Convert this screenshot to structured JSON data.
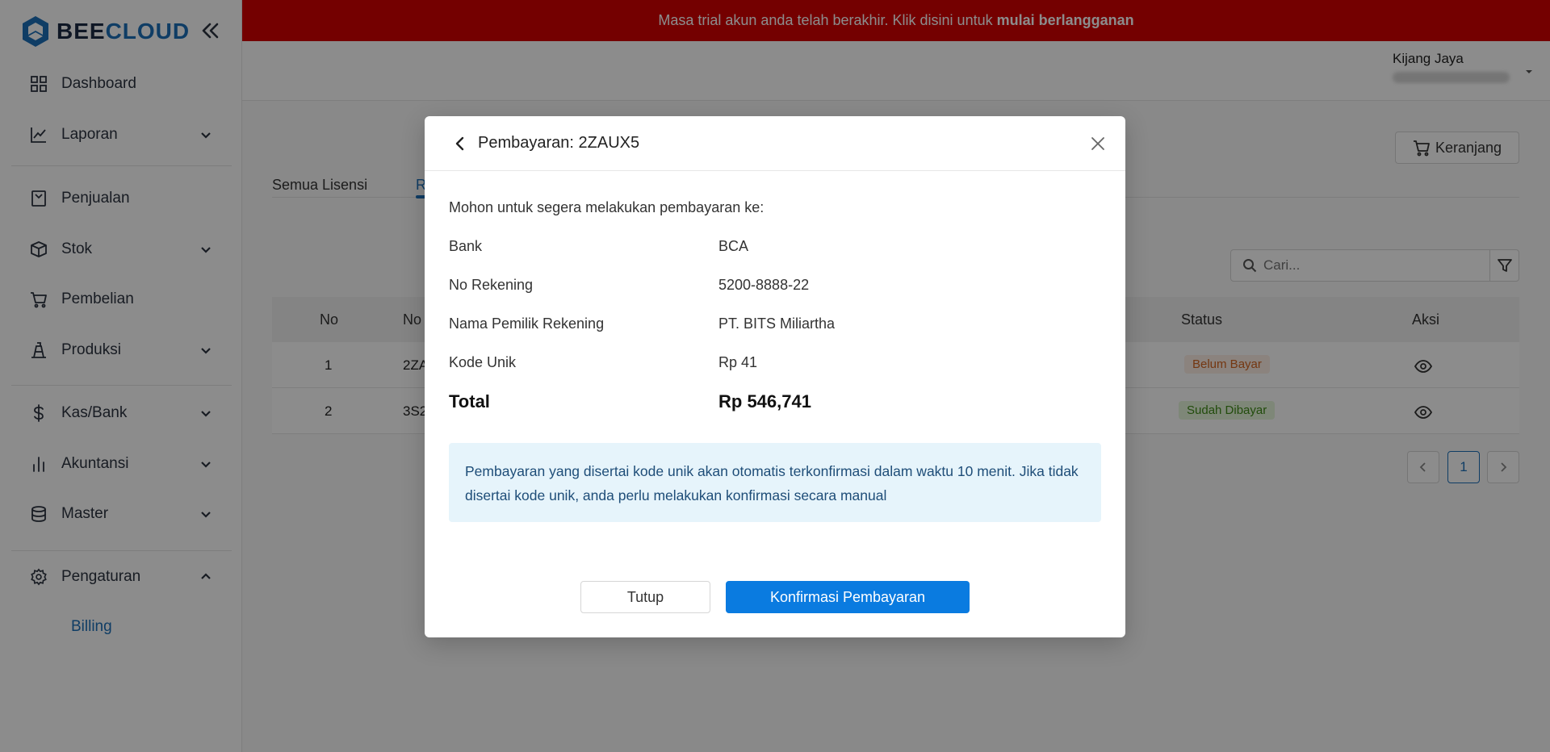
{
  "brand": {
    "logo_text_a": "BEE",
    "logo_text_b": "CLOUD"
  },
  "banner": {
    "text": "Masa trial akun anda telah berakhir. Klik disini untuk",
    "link": "mulai berlangganan"
  },
  "user": {
    "name": "Kijang Jaya"
  },
  "sidebar": {
    "items": [
      {
        "label": "Dashboard",
        "icon": "dashboard-icon"
      },
      {
        "label": "Laporan",
        "icon": "chart-icon"
      },
      {
        "label": "Penjualan",
        "icon": "sales-icon"
      },
      {
        "label": "Stok",
        "icon": "box-icon"
      },
      {
        "label": "Pembelian",
        "icon": "cart-icon"
      },
      {
        "label": "Produksi",
        "icon": "factory-icon"
      },
      {
        "label": "Kas/Bank",
        "icon": "dollar-icon"
      },
      {
        "label": "Akuntansi",
        "icon": "bar-chart-icon"
      },
      {
        "label": "Master",
        "icon": "database-icon"
      },
      {
        "label": "Pengaturan",
        "icon": "gear-icon"
      }
    ],
    "sub_billing": "Billing"
  },
  "content": {
    "cart_label": "Keranjang",
    "tabs": [
      "Semua Lisensi",
      "R"
    ],
    "search_placeholder": "Cari...",
    "table": {
      "headers": [
        "No",
        "No",
        "Status",
        "Aksi"
      ],
      "rows": [
        {
          "no": "1",
          "code": "2ZA",
          "status": "Belum Bayar"
        },
        {
          "no": "2",
          "code": "3S2",
          "status": "Sudah Dibayar"
        }
      ]
    },
    "pagination": {
      "current": "1"
    }
  },
  "modal": {
    "title": "Pembayaran: 2ZAUX5",
    "intro": "Mohon untuk segera melakukan pembayaran ke:",
    "rows": [
      {
        "label": "Bank",
        "value": "BCA"
      },
      {
        "label": "No Rekening",
        "value": "5200-8888-22"
      },
      {
        "label": "Nama Pemilik Rekening",
        "value": "PT. BITS Miliartha"
      },
      {
        "label": "Kode Unik",
        "value": "Rp 41"
      },
      {
        "label": "Total",
        "value": "Rp 546,741"
      }
    ],
    "info": "Pembayaran yang disertai kode unik akan otomatis terkonfirmasi dalam waktu 10 menit. Jika tidak disertai kode unik, anda perlu melakukan konfirmasi secara manual",
    "btn_close": "Tutup",
    "btn_confirm": "Konfirmasi Pembayaran"
  },
  "colors": {
    "banner": "#d30000",
    "primary": "#0a7be0",
    "brand_blue": "#1d6fb8",
    "info_bg": "#e6f4fb"
  }
}
